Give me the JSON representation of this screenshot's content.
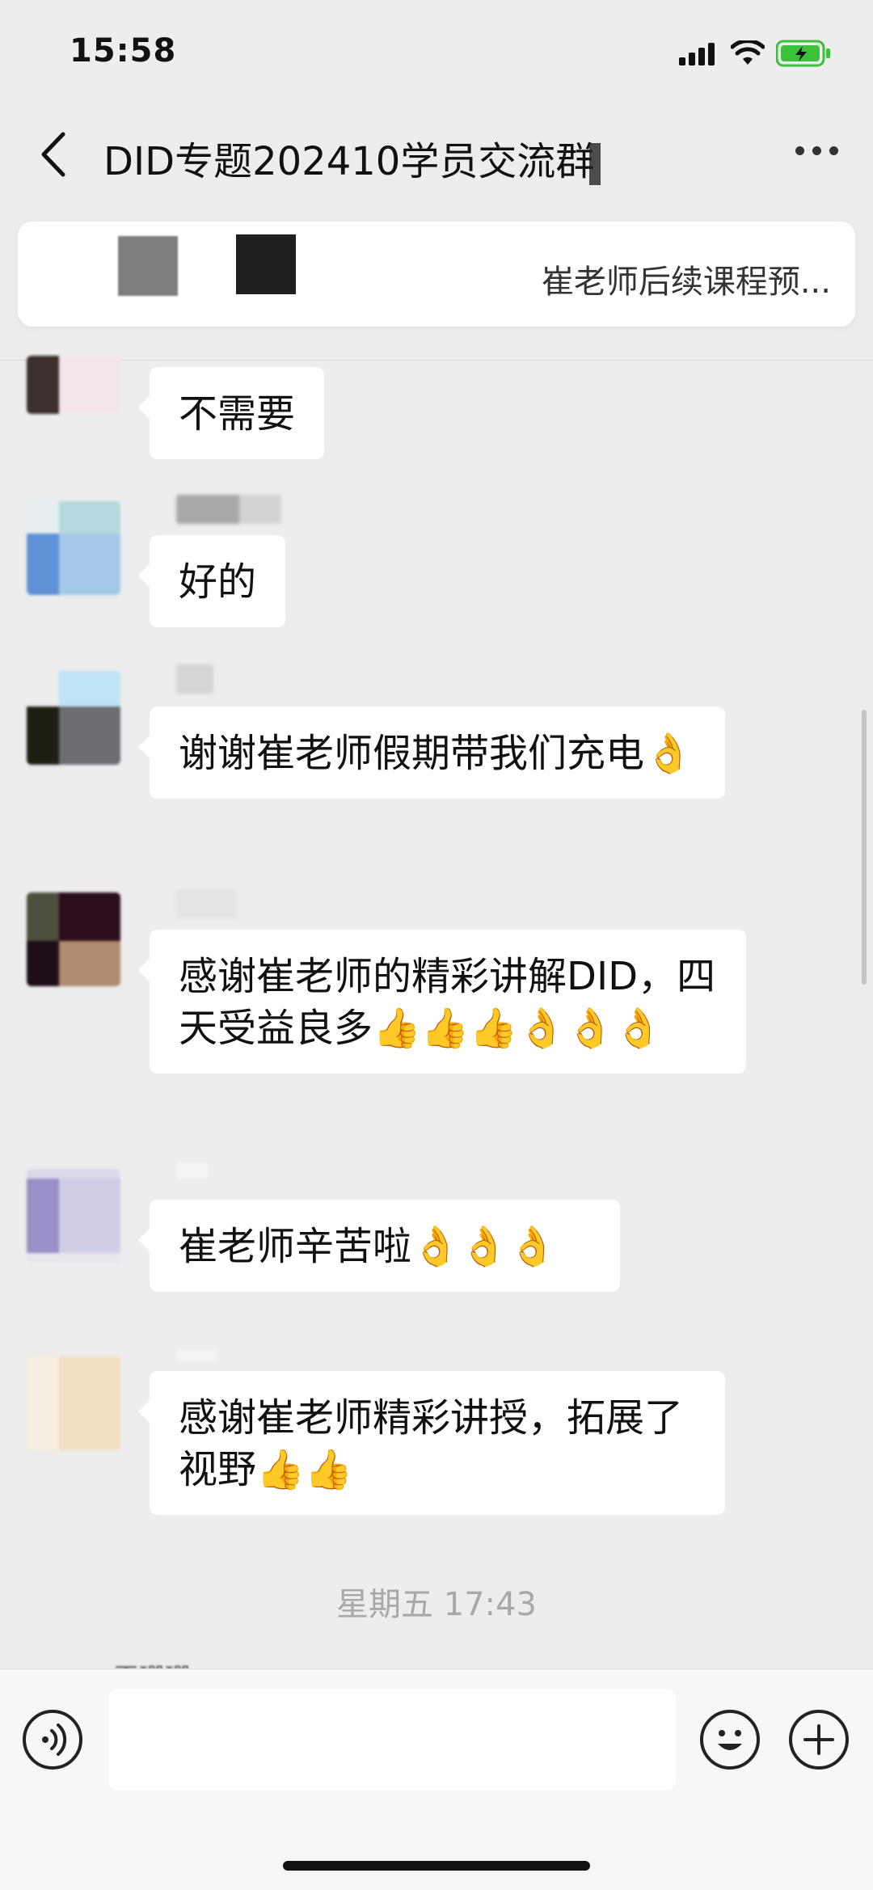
{
  "status_bar": {
    "time": "15:58"
  },
  "header": {
    "title": "DID专题202410学员交流群"
  },
  "pinned": {
    "text": "崔老师后续课程预..."
  },
  "messages": [
    {
      "text": "不需要"
    },
    {
      "text": "好的"
    },
    {
      "text": "谢谢崔老师假期带我们充电👌"
    },
    {
      "text": "感谢崔老师的精彩讲解DID，四天受益良多👍👍👍👌👌👌"
    },
    {
      "text": "崔老师辛苦啦👌👌👌"
    },
    {
      "text": "感谢崔老师精彩讲授，拓展了视野👍👍"
    }
  ],
  "timestamp": "星期五 17:43",
  "partial_sender": "王珊珊",
  "icons": {
    "back": "chevron-left-icon",
    "more": "more-dots-icon",
    "voice": "voice-icon",
    "emoji": "emoji-icon",
    "plus": "plus-icon",
    "signal": "signal-icon",
    "wifi": "wifi-icon",
    "battery": "battery-charging-icon"
  },
  "colors": {
    "background": "#ededed",
    "bubble": "#ffffff",
    "battery": "#3cc13b"
  }
}
